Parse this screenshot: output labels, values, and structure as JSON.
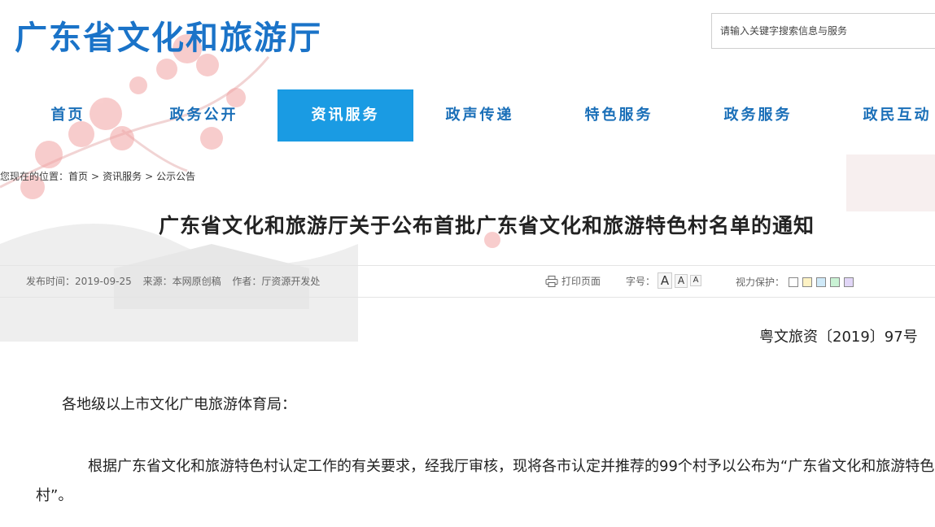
{
  "header": {
    "site_title": "广东省文化和旅游厅",
    "search_placeholder": "请输入关键字搜索信息与服务"
  },
  "nav": {
    "items": [
      {
        "label": "首页",
        "active": false
      },
      {
        "label": "政务公开",
        "active": false
      },
      {
        "label": "资讯服务",
        "active": true
      },
      {
        "label": "政声传递",
        "active": false
      },
      {
        "label": "特色服务",
        "active": false
      },
      {
        "label": "政务服务",
        "active": false
      },
      {
        "label": "政民互动",
        "active": false
      }
    ],
    "active_bg": "#1a9be3",
    "text_color": "#1a6fb8"
  },
  "breadcrumb": {
    "prefix": "您现在的位置：",
    "items": [
      "首页",
      "资讯服务",
      "公示公告"
    ],
    "separator": ">"
  },
  "article": {
    "title": "广东省文化和旅游厅关于公布首批广东省文化和旅游特色村名单的通知",
    "meta": {
      "publish_time": "发布时间：2019-09-25",
      "source": "来源：本网原创稿",
      "author": "作者：厅资源开发处"
    },
    "tools": {
      "print_label": "打印页面",
      "font_label": "字号：",
      "font_sizes": [
        "A",
        "A",
        "A"
      ],
      "vision_label": "视力保护：",
      "vision_colors": [
        "#ffffff",
        "#fdf2c4",
        "#cfe9f8",
        "#c9f2d4",
        "#e1d6f7"
      ]
    },
    "doc_number": "粤文旅资〔2019〕97号",
    "salutation": "各地级以上市文化广电旅游体育局：",
    "paragraph1": "根据广东省文化和旅游特色村认定工作的有关要求，经我厅审核，现将各市认定并推荐的99个村予以公布为“广东省文化和旅游特色村”。"
  },
  "icons": {
    "print": "printer-icon"
  }
}
